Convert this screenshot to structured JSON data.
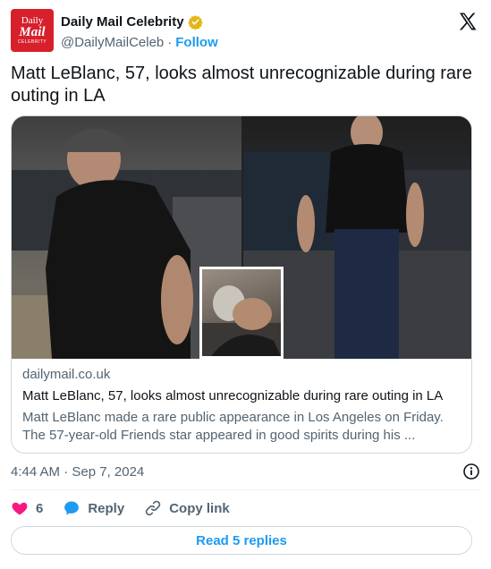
{
  "header": {
    "avatar": {
      "line1": "Daily",
      "line2": "Mail",
      "line3": "CELEBRITY"
    },
    "display_name": "Daily Mail Celebrity",
    "handle": "@DailyMailCeleb",
    "separator": "·",
    "follow_label": "Follow",
    "verified_icon": "verified-badge-icon",
    "brand_icon": "x-logo-icon"
  },
  "tweet": {
    "text": "Matt LeBlanc, 57, looks almost unrecognizable during rare outing in LA"
  },
  "card": {
    "images": [
      "photo-left",
      "photo-right",
      "photo-inset"
    ],
    "domain": "dailymail.co.uk",
    "title": "Matt LeBlanc, 57, looks almost unrecognizable during rare outing in LA",
    "description": "Matt LeBlanc made a rare public appearance in Los Angeles on Friday. The 57-year-old Friends star appeared in good spirits during his ..."
  },
  "meta": {
    "timestamp": "4:44 AM · Sep 7, 2024",
    "info_icon": "info-icon"
  },
  "actions": {
    "like_count": "6",
    "reply_label": "Reply",
    "copy_link_label": "Copy link"
  },
  "read_replies_label": "Read 5 replies",
  "colors": {
    "accent": "#1d9bf0",
    "like": "#f91880",
    "avatar_bg": "#d6202b",
    "verified": "#e2b719",
    "secondary_text": "#536471"
  }
}
